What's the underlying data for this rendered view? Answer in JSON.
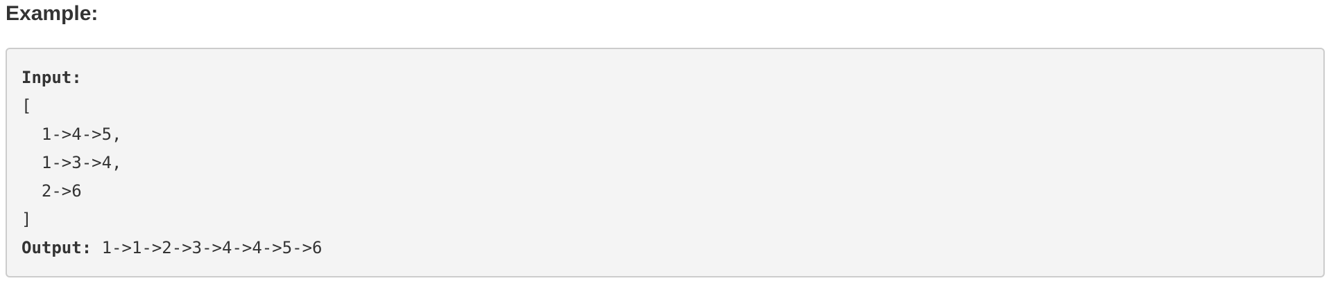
{
  "heading": "Example:",
  "code": {
    "input_label": "Input:",
    "input_lines": [
      "[",
      "  1->4->5,",
      "  1->3->4,",
      "  2->6",
      "]"
    ],
    "output_label": "Output:",
    "output_value": " 1->1->2->3->4->4->5->6"
  }
}
